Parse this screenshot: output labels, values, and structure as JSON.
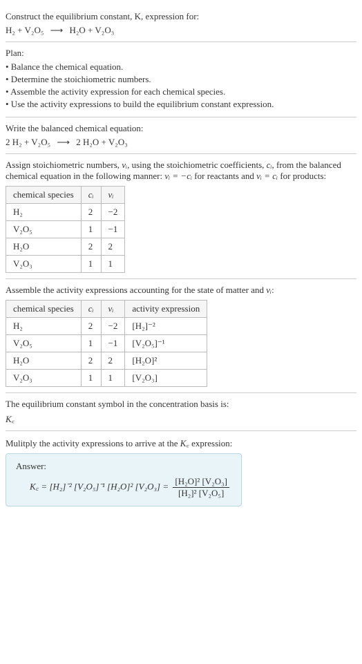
{
  "section1": {
    "title": "Construct the equilibrium constant, K, expression for:",
    "eq_left": "H₂ + V₂O₅",
    "arrow": "⟶",
    "eq_right": "H₂O + V₂O₃"
  },
  "section2": {
    "title": "Plan:",
    "b1": "• Balance the chemical equation.",
    "b2": "• Determine the stoichiometric numbers.",
    "b3": "• Assemble the activity expression for each chemical species.",
    "b4": "• Use the activity expressions to build the equilibrium constant expression."
  },
  "section3": {
    "title": "Write the balanced chemical equation:",
    "eq_left": "2 H₂ + V₂O₅",
    "arrow": "⟶",
    "eq_right": "2 H₂O + V₂O₃"
  },
  "section4": {
    "intro_part1": "Assign stoichiometric numbers, ",
    "nu_i": "νᵢ",
    "intro_part2": ", using the stoichiometric coefficients, ",
    "c_i": "cᵢ",
    "intro_part3": ", from the balanced chemical equation in the following manner: ",
    "rel1": "νᵢ = −cᵢ",
    "intro_part4": " for reactants and ",
    "rel2": "νᵢ = cᵢ",
    "intro_part5": " for products:",
    "headers": {
      "h1": "chemical species",
      "h2": "cᵢ",
      "h3": "νᵢ"
    },
    "rows": [
      {
        "species": "H₂",
        "c": "2",
        "nu": "−2"
      },
      {
        "species": "V₂O₅",
        "c": "1",
        "nu": "−1"
      },
      {
        "species": "H₂O",
        "c": "2",
        "nu": "2"
      },
      {
        "species": "V₂O₃",
        "c": "1",
        "nu": "1"
      }
    ]
  },
  "section5": {
    "title_part1": "Assemble the activity expressions accounting for the state of matter and ",
    "nu_i": "νᵢ",
    "title_part2": ":",
    "headers": {
      "h1": "chemical species",
      "h2": "cᵢ",
      "h3": "νᵢ",
      "h4": "activity expression"
    },
    "rows": [
      {
        "species": "H₂",
        "c": "2",
        "nu": "−2",
        "act": "[H₂]⁻²"
      },
      {
        "species": "V₂O₅",
        "c": "1",
        "nu": "−1",
        "act": "[V₂O₅]⁻¹"
      },
      {
        "species": "H₂O",
        "c": "2",
        "nu": "2",
        "act": "[H₂O]²"
      },
      {
        "species": "V₂O₃",
        "c": "1",
        "nu": "1",
        "act": "[V₂O₃]"
      }
    ]
  },
  "section6": {
    "title": "The equilibrium constant symbol in the concentration basis is:",
    "symbol": "K꜀"
  },
  "section7": {
    "title_part1": "Mulitply the activity expressions to arrive at the ",
    "kc": "K꜀",
    "title_part2": " expression:",
    "answer_label": "Answer:",
    "lhs": "K꜀ = [H₂]⁻² [V₂O₅]⁻¹ [H₂O]² [V₂O₃] = ",
    "num": "[H₂O]² [V₂O₃]",
    "den": "[H₂]² [V₂O₅]"
  }
}
